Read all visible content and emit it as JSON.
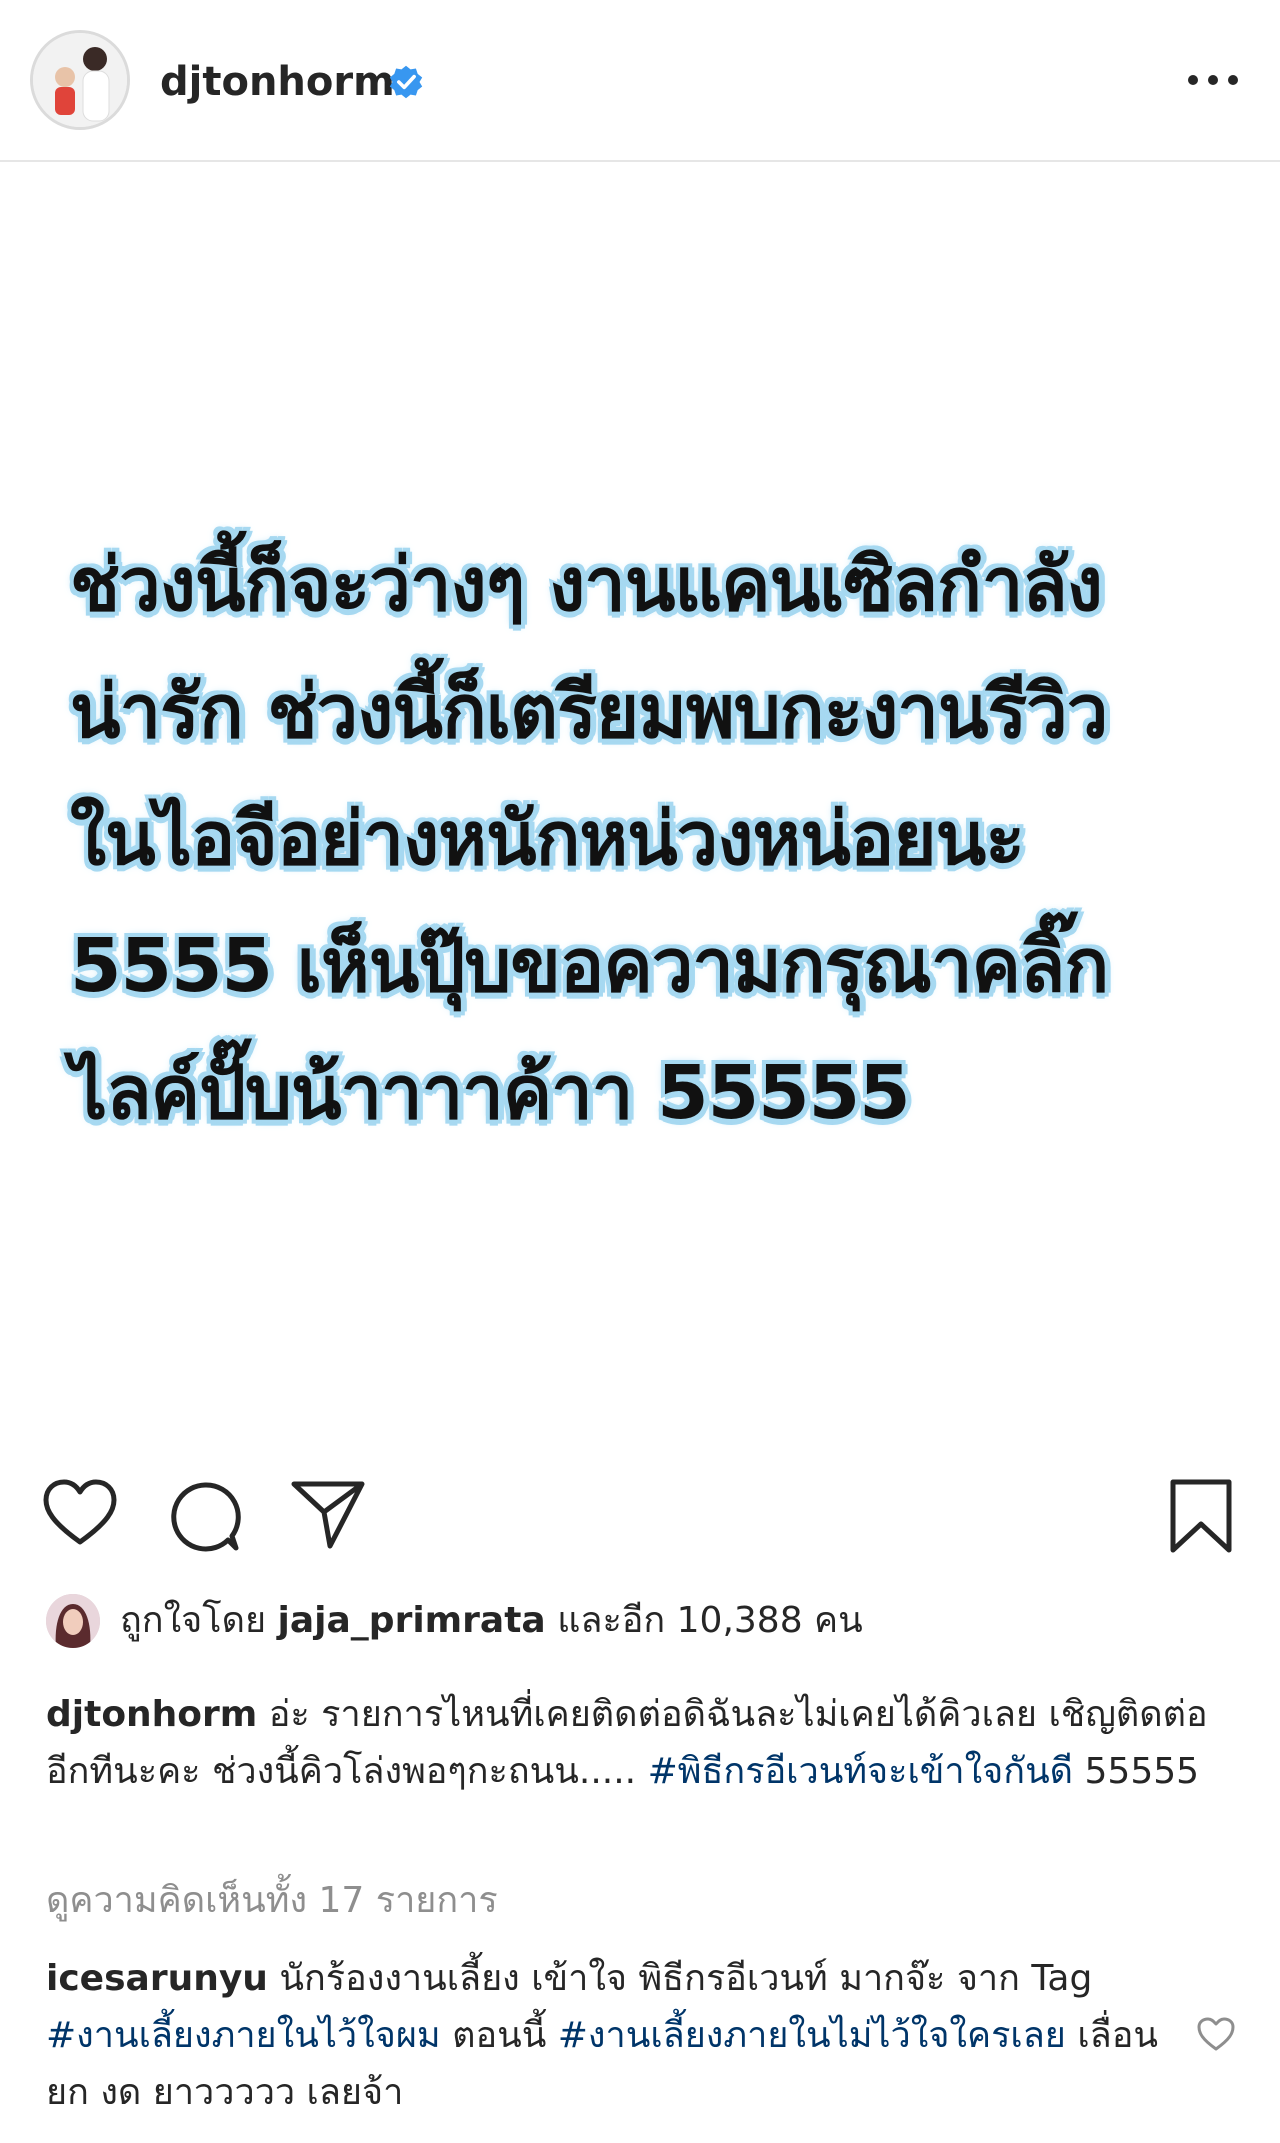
{
  "header": {
    "username": "djtonhorm",
    "verified_icon": "verified-badge-icon",
    "more_icon": "more-options-icon"
  },
  "post": {
    "text_lines": [
      "ช่วงนี้ก็จะว่างๆ งานแคนเซิลกำลัง",
      "น่ารัก ช่วงนี้ก็เตรียมพบกะงานรีวิว",
      "ในไอจีอย่างหนักหน่วงหน่อยนะ",
      "5555 เห็นปุ๊บขอความกรุณาคลิ๊ก",
      "ไลค์ปั๊บน้าาาาค้าา 55555"
    ]
  },
  "actions": {
    "like_icon": "heart-icon",
    "comment_icon": "comment-icon",
    "share_icon": "share-icon",
    "save_icon": "bookmark-icon"
  },
  "likes": {
    "prefix": "ถูกใจโดย",
    "user": "jaja_primrata",
    "suffix": "และอีก 10,388 คน"
  },
  "caption": {
    "username": "djtonhorm",
    "text": " อ่ะ รายการไหนที่เคยติดต่อดิฉันละไม่เคยได้คิวเลย เชิญติดต่ออีกทีนะคะ ช่วงนี้คิวโล่งพอๆกะถนน..... ",
    "hashtag": "#พิธีกรอีเวนท์จะเข้าใจกันดี",
    "tail": " 55555"
  },
  "view_all_comments": "ดูความคิดเห็นทั้ง 17 รายการ",
  "comment": {
    "username": "icesarunyu",
    "text1": " นักร้องงานเลี้ยง เข้าใจ พิธีกรอีเวนท์ มากจ๊ะ จาก Tag ",
    "hashtag1": "#งานเลี้ยงภายในไว้ใจผม",
    "text2": " ตอนนี้ ",
    "hashtag2": "#งานเลี้ยงภายในไม่ไว้ใจใครเลย",
    "text3": " เลื่อน ยก งด ยาววววว เลยจ้า"
  },
  "colors": {
    "text": "#262626",
    "hashtag": "#003569",
    "muted": "#8e8e8e",
    "verified": "#3897f0",
    "text_glow": "#a7d9f1"
  }
}
